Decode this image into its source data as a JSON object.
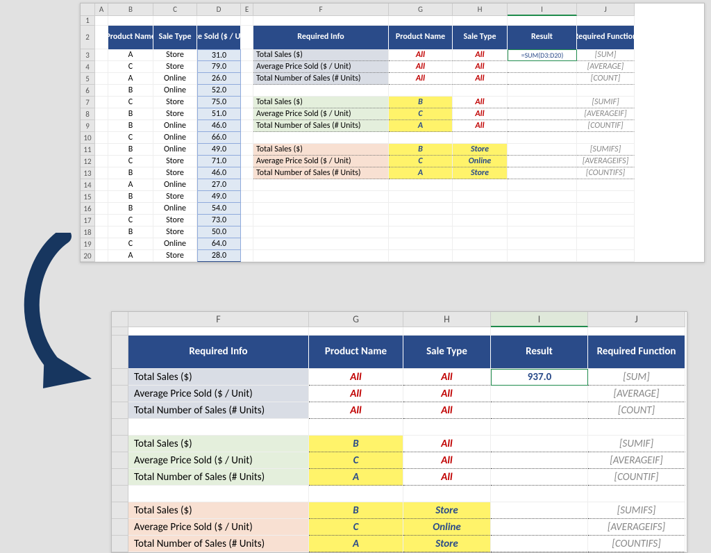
{
  "top": {
    "cols": [
      "A",
      "B",
      "C",
      "D",
      "E",
      "F",
      "G",
      "H",
      "I",
      "J"
    ],
    "headers": {
      "product_name": "Product Name",
      "sale_type": "Sale Type",
      "price_sold": "Price Sold ($ / Unit)",
      "required_info": "Required Info",
      "pn": "Product Name",
      "st": "Sale Type",
      "result": "Result",
      "req_func": "Required Function"
    },
    "rows": [
      {
        "n": 3,
        "p": "A",
        "s": "Store",
        "v": "31.0"
      },
      {
        "n": 4,
        "p": "C",
        "s": "Store",
        "v": "79.0"
      },
      {
        "n": 5,
        "p": "A",
        "s": "Online",
        "v": "26.0"
      },
      {
        "n": 6,
        "p": "B",
        "s": "Online",
        "v": "52.0"
      },
      {
        "n": 7,
        "p": "C",
        "s": "Store",
        "v": "75.0"
      },
      {
        "n": 8,
        "p": "B",
        "s": "Store",
        "v": "51.0"
      },
      {
        "n": 9,
        "p": "B",
        "s": "Online",
        "v": "46.0"
      },
      {
        "n": 10,
        "p": "C",
        "s": "Online",
        "v": "66.0"
      },
      {
        "n": 11,
        "p": "B",
        "s": "Online",
        "v": "49.0"
      },
      {
        "n": 12,
        "p": "C",
        "s": "Store",
        "v": "71.0"
      },
      {
        "n": 13,
        "p": "B",
        "s": "Store",
        "v": "46.0"
      },
      {
        "n": 14,
        "p": "A",
        "s": "Online",
        "v": "27.0"
      },
      {
        "n": 15,
        "p": "B",
        "s": "Store",
        "v": "49.0"
      },
      {
        "n": 16,
        "p": "B",
        "s": "Online",
        "v": "54.0"
      },
      {
        "n": 17,
        "p": "C",
        "s": "Store",
        "v": "73.0"
      },
      {
        "n": 18,
        "p": "B",
        "s": "Store",
        "v": "50.0"
      },
      {
        "n": 19,
        "p": "C",
        "s": "Online",
        "v": "64.0"
      },
      {
        "n": 20,
        "p": "A",
        "s": "Store",
        "v": "28.0"
      }
    ],
    "info_groups": [
      {
        "cls": "info1",
        "rows": [
          {
            "label": "Total Sales ($)",
            "g": "All",
            "h": "All",
            "i": "=SUM(D3:D20)",
            "j": "[SUM]",
            "formula": true
          },
          {
            "label": "Average Price Sold ($ / Unit)",
            "g": "All",
            "h": "All",
            "i": "",
            "j": "[AVERAGE]"
          },
          {
            "label": "Total Number of Sales (# Units)",
            "g": "All",
            "h": "All",
            "i": "",
            "j": "[COUNT]"
          }
        ]
      },
      {
        "cls": "info2",
        "rows": [
          {
            "label": "Total Sales ($)",
            "g": "B",
            "h": "All",
            "i": "",
            "j": "[SUMIF]",
            "ghi": true
          },
          {
            "label": "Average Price Sold ($ / Unit)",
            "g": "C",
            "h": "All",
            "i": "",
            "j": "[AVERAGEIF]",
            "ghi": true
          },
          {
            "label": "Total Number of Sales (# Units)",
            "g": "A",
            "h": "All",
            "i": "",
            "j": "[COUNTIF]",
            "ghi": true
          }
        ]
      },
      {
        "cls": "info3",
        "rows": [
          {
            "label": "Total Sales ($)",
            "g": "B",
            "h": "Store",
            "i": "",
            "j": "[SUMIFS]",
            "ghi": true,
            "hhi": true
          },
          {
            "label": "Average Price Sold ($ / Unit)",
            "g": "C",
            "h": "Online",
            "i": "",
            "j": "[AVERAGEIFS]",
            "ghi": true,
            "hhi": true
          },
          {
            "label": "Total Number of Sales (# Units)",
            "g": "A",
            "h": "Store",
            "i": "",
            "j": "[COUNTIFS]",
            "ghi": true,
            "hhi": true
          }
        ]
      }
    ]
  },
  "bottom": {
    "cols": [
      "F",
      "G",
      "H",
      "I",
      "J"
    ],
    "headers": {
      "required_info": "Required Info",
      "pn": "Product Name",
      "st": "Sale Type",
      "result": "Result",
      "req_func": "Required Function"
    },
    "result_value": "937.0",
    "groups": [
      {
        "cls": "info1",
        "rows": [
          {
            "label": "Total Sales ($)",
            "g": "All",
            "h": "All",
            "res": true,
            "j": "[SUM]"
          },
          {
            "label": "Average Price Sold ($ / Unit)",
            "g": "All",
            "h": "All",
            "j": "[AVERAGE]"
          },
          {
            "label": "Total Number of Sales (# Units)",
            "g": "All",
            "h": "All",
            "j": "[COUNT]"
          }
        ]
      },
      {
        "cls": "info2",
        "rows": [
          {
            "label": "Total Sales ($)",
            "g": "B",
            "h": "All",
            "j": "[SUMIF]",
            "ghi": true
          },
          {
            "label": "Average Price Sold ($ / Unit)",
            "g": "C",
            "h": "All",
            "j": "[AVERAGEIF]",
            "ghi": true
          },
          {
            "label": "Total Number of Sales (# Units)",
            "g": "A",
            "h": "All",
            "j": "[COUNTIF]",
            "ghi": true
          }
        ]
      },
      {
        "cls": "info3",
        "rows": [
          {
            "label": "Total Sales ($)",
            "g": "B",
            "h": "Store",
            "j": "[SUMIFS]",
            "ghi": true,
            "hhi": true
          },
          {
            "label": "Average Price Sold ($ / Unit)",
            "g": "C",
            "h": "Online",
            "j": "[AVERAGEIFS]",
            "ghi": true,
            "hhi": true
          },
          {
            "label": "Total Number of Sales (# Units)",
            "g": "A",
            "h": "Store",
            "j": "[COUNTIFS]",
            "ghi": true,
            "hhi": true
          }
        ]
      }
    ]
  }
}
